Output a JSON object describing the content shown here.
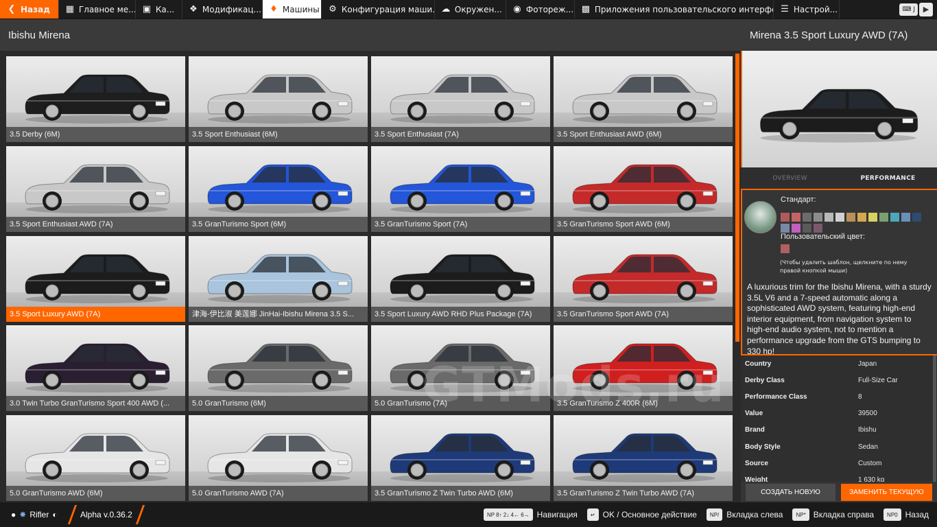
{
  "topbar": {
    "back": "Назад",
    "tabs": [
      {
        "label": "Главное ме...",
        "icon": "grid-icon"
      },
      {
        "label": "Ка...",
        "icon": "map-icon"
      },
      {
        "label": "Модификац...",
        "icon": "puzzle-icon"
      },
      {
        "label": "Машины",
        "icon": "car-icon"
      },
      {
        "label": "Конфигурация маши...",
        "icon": "engine-icon"
      },
      {
        "label": "Окружен...",
        "icon": "weather-icon"
      },
      {
        "label": "Фотореж...",
        "icon": "camera-icon"
      },
      {
        "label": "Приложения пользовательского интерфе...",
        "icon": "apps-icon"
      },
      {
        "label": "Настрой...",
        "icon": "sliders-icon"
      }
    ],
    "shortcut_key": "J"
  },
  "header": {
    "title": "Ibishu Mirena"
  },
  "configs": [
    {
      "label": "3.5 Derby (6M)",
      "color": "#1e1e1e"
    },
    {
      "label": "3.5 Sport Enthusiast (6M)",
      "color": "#c8c8c8"
    },
    {
      "label": "3.5 Sport Enthusiast (7A)",
      "color": "#c8c8c8"
    },
    {
      "label": "3.5 Sport Enthusiast AWD (6M)",
      "color": "#c8c8c8"
    },
    {
      "label": "3.5 Sport Enthusiast AWD (7A)",
      "color": "#c8c8c8"
    },
    {
      "label": "3.5 GranTurismo Sport (6M)",
      "color": "#2356d8"
    },
    {
      "label": "3.5 GranTurismo Sport (7A)",
      "color": "#2356d8"
    },
    {
      "label": "3.5 GranTurismo Sport AWD (6M)",
      "color": "#c42a2a"
    },
    {
      "label": "3.5 Sport Luxury AWD (7A)",
      "color": "#1c1c1c"
    },
    {
      "label": "津海-伊比淑 美莲娜 JinHai-Ibishu Mirena 3.5 S...",
      "color": "#a9c4dc"
    },
    {
      "label": "3.5 Sport Luxury AWD RHD Plus Package (7A)",
      "color": "#1c1c1c"
    },
    {
      "label": "3.5 GranTurismo Sport AWD (7A)",
      "color": "#c42a2a"
    },
    {
      "label": "3.0 Twin Turbo GranTurismo Sport 400 AWD (...",
      "color": "#2a1f30"
    },
    {
      "label": "5.0 GranTurismo (6M)",
      "color": "#6a6a6a"
    },
    {
      "label": "5.0 GranTurismo (7A)",
      "color": "#6a6a6a"
    },
    {
      "label": "3.5 GranTurismo Z 400R (6M)",
      "color": "#d01f1f"
    },
    {
      "label": "5.0 GranTurismo AWD (6M)",
      "color": "#e6e6e6"
    },
    {
      "label": "5.0 GranTurismo AWD (7A)",
      "color": "#e6e6e6"
    },
    {
      "label": "3.5 GranTurismo Z Twin Turbo AWD (6M)",
      "color": "#1e3a78"
    },
    {
      "label": "3.5 GranTurismo Z Twin Turbo AWD (7A)",
      "color": "#1e3a78"
    }
  ],
  "selected_index": 8,
  "panel": {
    "title": "Mirena 3.5 Sport Luxury AWD (7A)",
    "preview_color": "#1c1c1c",
    "tabs": [
      "OVERVIEW",
      "PERFORMANCE"
    ],
    "standard_label": "Стандарт:",
    "swatches": [
      "#b05a5a",
      "#c46464",
      "#6c6c6c",
      "#8c8c8c",
      "#b8b8b8",
      "#d0d0d0",
      "#b89058",
      "#d4a850",
      "#d8d060",
      "#7aa070",
      "#4aa8b8",
      "#6890b8",
      "#2e4a70",
      "#7888a8",
      "#c060c0",
      "#5a5a5a",
      "#7a5a6a"
    ],
    "custom_label": "Пользовательский цвет:",
    "custom_swatch": "#b06060",
    "hint": "(Чтобы удалить шаблон, щелкните по нему правой кнопкой мыши)",
    "description": "A luxurious trim for the Ibishu Mirena, with a sturdy 3.5L V6 and a 7-speed automatic along a sophisticated AWD system, featuring high-end interior equipment, from navigation system to high-end audio system, not to mention a performance upgrade from the GTS bumping to 330 hp!",
    "info": [
      {
        "key": "Country",
        "value": "Japan"
      },
      {
        "key": "Derby Class",
        "value": "Full-Size Car"
      },
      {
        "key": "Performance Class",
        "value": "8"
      },
      {
        "key": "Value",
        "value": "39500"
      },
      {
        "key": "Brand",
        "value": "Ibishu"
      },
      {
        "key": "Body Style",
        "value": "Sedan"
      },
      {
        "key": "Source",
        "value": "Custom"
      },
      {
        "key": "Weight",
        "value": "1 630 kg"
      }
    ],
    "create_button": "СОЗДАТЬ НОВУЮ",
    "replace_button": "ЗАМЕНИТЬ ТЕКУЩУЮ"
  },
  "bottombar": {
    "user": "Rifler",
    "version": "Alpha v.0.36.2",
    "hints": [
      {
        "keys": "NP 8↑ 2↓ 4← 6→",
        "label": "Навигация"
      },
      {
        "keys": "↵",
        "label": "OK / Основное действие"
      },
      {
        "keys": "NP/",
        "label": "Вкладка слева"
      },
      {
        "keys": "NP*",
        "label": "Вкладка справа"
      },
      {
        "keys": "NP0",
        "label": "Назад"
      }
    ]
  },
  "watermark": "GTMods.ru"
}
